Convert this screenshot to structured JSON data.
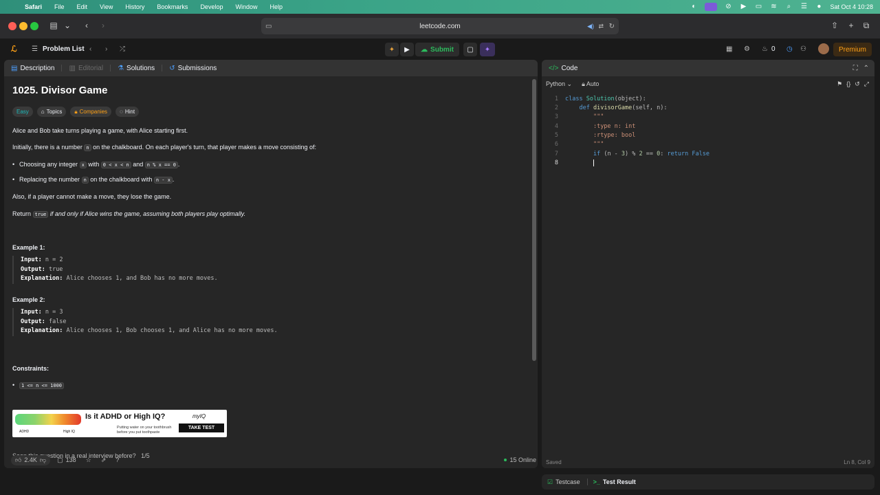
{
  "menubar": {
    "app": "Safari",
    "items": [
      "File",
      "Edit",
      "View",
      "History",
      "Bookmarks",
      "Develop",
      "Window",
      "Help"
    ],
    "clock": "Sat Oct 4  10:28"
  },
  "browser": {
    "url": "leetcode.com"
  },
  "nav": {
    "problem_list": "Problem List",
    "submit": "Submit",
    "streak": "0",
    "premium": "Premium"
  },
  "left_tabs": [
    "Description",
    "Editorial",
    "Solutions",
    "Submissions"
  ],
  "problem": {
    "title": "1025. Divisor Game",
    "chips": [
      "Easy",
      "Topics",
      "Companies",
      "Hint"
    ],
    "p1": "Alice and Bob take turns playing a game, with Alice starting first.",
    "p2a": "Initially, there is a number ",
    "p2code": "n",
    "p2b": " on the chalkboard. On each player's turn, that player makes a move consisting of:",
    "b1a": "Choosing any integer ",
    "b1c1": "x",
    "b1b": " with ",
    "b1c2": "0 < x < n",
    "b1c": " and ",
    "b1c3": "n % x == 0",
    "b1d": ".",
    "b2a": "Replacing the number ",
    "b2c1": "n",
    "b2b": " on the chalkboard with ",
    "b2c2": "n - x",
    "b2c": ".",
    "p3": "Also, if a player cannot make a move, they lose the game.",
    "p4a": "Return ",
    "p4code": "true",
    "p4b": " if and only if Alice wins the game, assuming both players play optimally.",
    "ex1_title": "Example 1:",
    "ex1_input": "n = 2",
    "ex1_output": "true",
    "ex1_expl": "Alice chooses 1, and Bob has no more moves.",
    "ex2_title": "Example 2:",
    "ex2_input": "n = 3",
    "ex2_output": "false",
    "ex2_expl": "Alice chooses 1, Bob chooses 1, and Alice has no more moves.",
    "label_input": "Input:",
    "label_output": "Output:",
    "label_expl": "Explanation:",
    "constraints_title": "Constraints:",
    "constraint1": "1 <= n <= 1000",
    "seen": "Seen this question in a real interview before?",
    "seen_count": "1/5"
  },
  "ad": {
    "headline": "Is it ADHD or High IQ?",
    "sub1": "Putting water on your toothbrush",
    "sub2": "before you put toothpaste",
    "cta": "TAKE TEST",
    "brand": "myIQ",
    "left": "ADHD",
    "right": "High IQ"
  },
  "footer": {
    "likes": "2.4K",
    "comments": "138",
    "online": "15 Online"
  },
  "code_panel": {
    "title": "Code",
    "lang": "Python",
    "auto": "Auto",
    "status": "Saved",
    "position": "Ln 8, Col 9",
    "lines": [
      "1",
      "2",
      "3",
      "4",
      "5",
      "6",
      "7",
      "8"
    ]
  },
  "bottom": {
    "testcase": "Testcase",
    "result": "Test Result"
  },
  "colors": {
    "accent": "#ffa116",
    "easy": "#1cbaba",
    "submit": "#2cbb5d"
  }
}
